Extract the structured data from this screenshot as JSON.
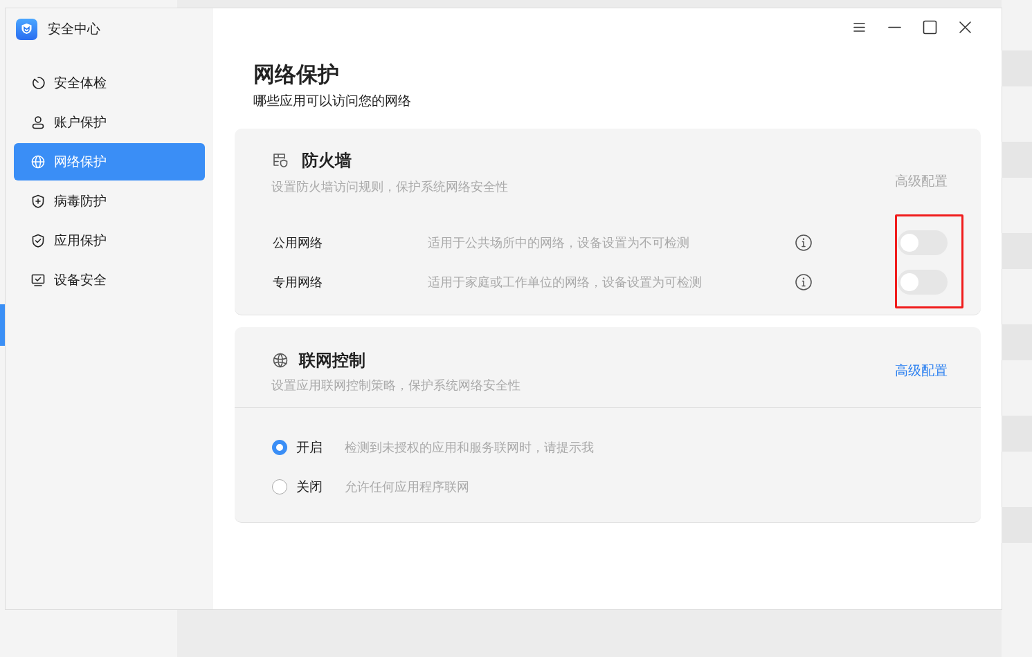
{
  "app": {
    "title": "安全中心"
  },
  "sidebar": {
    "items": [
      {
        "label": "安全体检",
        "kind": "scan",
        "selected": false
      },
      {
        "label": "账户保护",
        "kind": "account",
        "selected": false
      },
      {
        "label": "网络保护",
        "kind": "network",
        "selected": true
      },
      {
        "label": "病毒防护",
        "kind": "virus",
        "selected": false
      },
      {
        "label": "应用保护",
        "kind": "app",
        "selected": false
      },
      {
        "label": "设备安全",
        "kind": "device",
        "selected": false
      }
    ]
  },
  "page": {
    "title": "网络保护",
    "subtitle": "哪些应用可以访问您的网络"
  },
  "firewall": {
    "title": "防火墙",
    "description": "设置防火墙访问规则，保护系统网络安全性",
    "advanced_link": {
      "label": "高级配置",
      "disabled": true
    },
    "networks": [
      {
        "name": "公用网络",
        "description": "适用于公共场所中的网络，设备设置为不可检测",
        "on": false
      },
      {
        "name": "专用网络",
        "description": "适用于家庭或工作单位的网络，设备设置为可检测",
        "on": false
      }
    ]
  },
  "network_control": {
    "title": "联网控制",
    "description": "设置应用联网控制策略，保护系统网络安全性",
    "advanced_link": {
      "label": "高级配置",
      "disabled": false
    },
    "options": [
      {
        "label": "开启",
        "description": "检测到未授权的应用和服务联网时，请提示我",
        "selected": true
      },
      {
        "label": "关闭",
        "description": "允许任何应用程序联网",
        "selected": false
      }
    ]
  }
}
